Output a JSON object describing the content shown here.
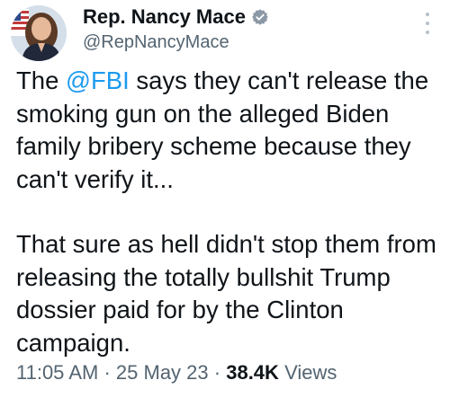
{
  "author": {
    "display_name": "Rep. Nancy Mace",
    "handle": "@RepNancyMace",
    "verified_color": "#1d9bf0"
  },
  "tweet": {
    "para1_before": "The ",
    "para1_mention": "@FBI",
    "para1_after": " says they can't release the smoking gun on the alleged Biden family bribery scheme because they can't verify it...",
    "para2": "That sure as hell didn't stop them from releasing the totally bullshit Trump dossier paid for by the Clinton campaign."
  },
  "meta": {
    "time": "11:05 AM",
    "separator": "·",
    "date": "25 May 23",
    "views_count": "38.4K",
    "views_label": "Views"
  },
  "colors": {
    "text": "#0f1419",
    "secondary": "#536471",
    "link": "#1d9bf0"
  }
}
